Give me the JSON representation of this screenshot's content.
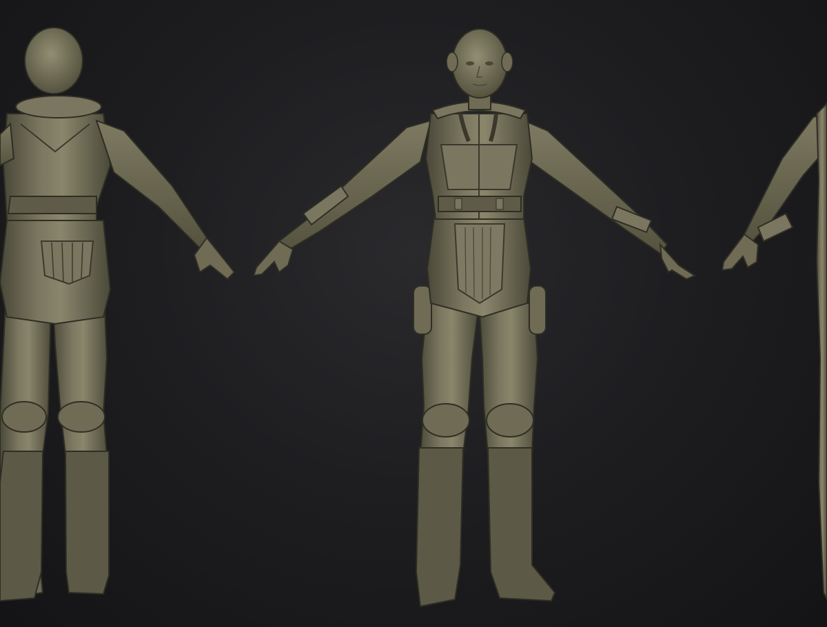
{
  "scene": {
    "description_free": true,
    "views": [
      {
        "id": "back-view"
      },
      {
        "id": "front-view"
      },
      {
        "id": "side-view"
      }
    ]
  },
  "colors": {
    "background_center": "#2a2a2d",
    "background_edge": "#141416",
    "clay_base": "#69664f",
    "clay_light": "#8f8b70",
    "clay_dark": "#3f3d2f",
    "clay_shadow": "#2c2b22"
  }
}
